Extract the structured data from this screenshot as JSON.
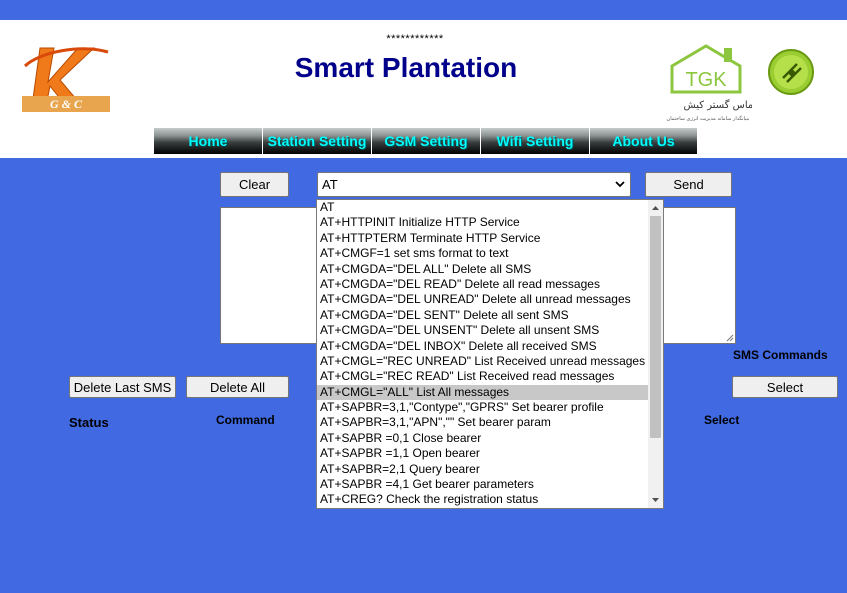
{
  "header": {
    "stars": "************",
    "title": "Smart Plantation",
    "logo_left_text": "G & C",
    "logo_tgk_text": "TGK",
    "logo_tgk_subtitle": "تماس گستر کیش",
    "logo_tgk_tagline": "بنیانگذار سامانه مدیریت انرژی ساختمان"
  },
  "nav": {
    "items": [
      "Home",
      "Station Setting",
      "GSM Setting",
      "Wifi Setting",
      "About Us"
    ]
  },
  "controls": {
    "clear_label": "Clear",
    "send_label": "Send",
    "selected_command": "AT",
    "delete_last_label": "Delete Last SMS",
    "delete_all_label": "Delete All",
    "select_label": "Select",
    "sms_commands_label": "SMS Commands"
  },
  "table_headers": {
    "status": "Status",
    "command": "Command",
    "select": "Select"
  },
  "dropdown": {
    "selected_index": 12,
    "options": [
      "AT",
      "AT+HTTPINIT Initialize HTTP Service",
      "AT+HTTPTERM Terminate HTTP Service",
      "AT+CMGF=1 set sms format to text",
      "AT+CMGDA=\"DEL ALL\" Delete all SMS",
      "AT+CMGDA=\"DEL READ\" Delete all read messages",
      "AT+CMGDA=\"DEL UNREAD\" Delete all unread messages",
      "AT+CMGDA=\"DEL SENT\" Delete all sent SMS",
      "AT+CMGDA=\"DEL UNSENT\" Delete all unsent SMS",
      "AT+CMGDA=\"DEL INBOX\" Delete all received SMS",
      "AT+CMGL=\"REC UNREAD\" List Received unread messages",
      "AT+CMGL=\"REC READ\" List Received read messages",
      "AT+CMGL=\"ALL\" List All messages",
      "AT+SAPBR=3,1,\"Contype\",\"GPRS\" Set bearer profile",
      "AT+SAPBR=3,1,\"APN\",\"\" Set bearer param",
      "AT+SAPBR =0,1 Close bearer",
      "AT+SAPBR =1,1 Open bearer",
      "AT+SAPBR=2,1 Query bearer",
      "AT+SAPBR =4,1 Get bearer parameters",
      "AT+CREG? Check the registration status"
    ]
  },
  "colors": {
    "background": "#4169e1",
    "title": "#00008b",
    "nav_text": "#00ffff",
    "logo_orange": "#f07a1a",
    "tgk_green": "#8cc63f"
  }
}
